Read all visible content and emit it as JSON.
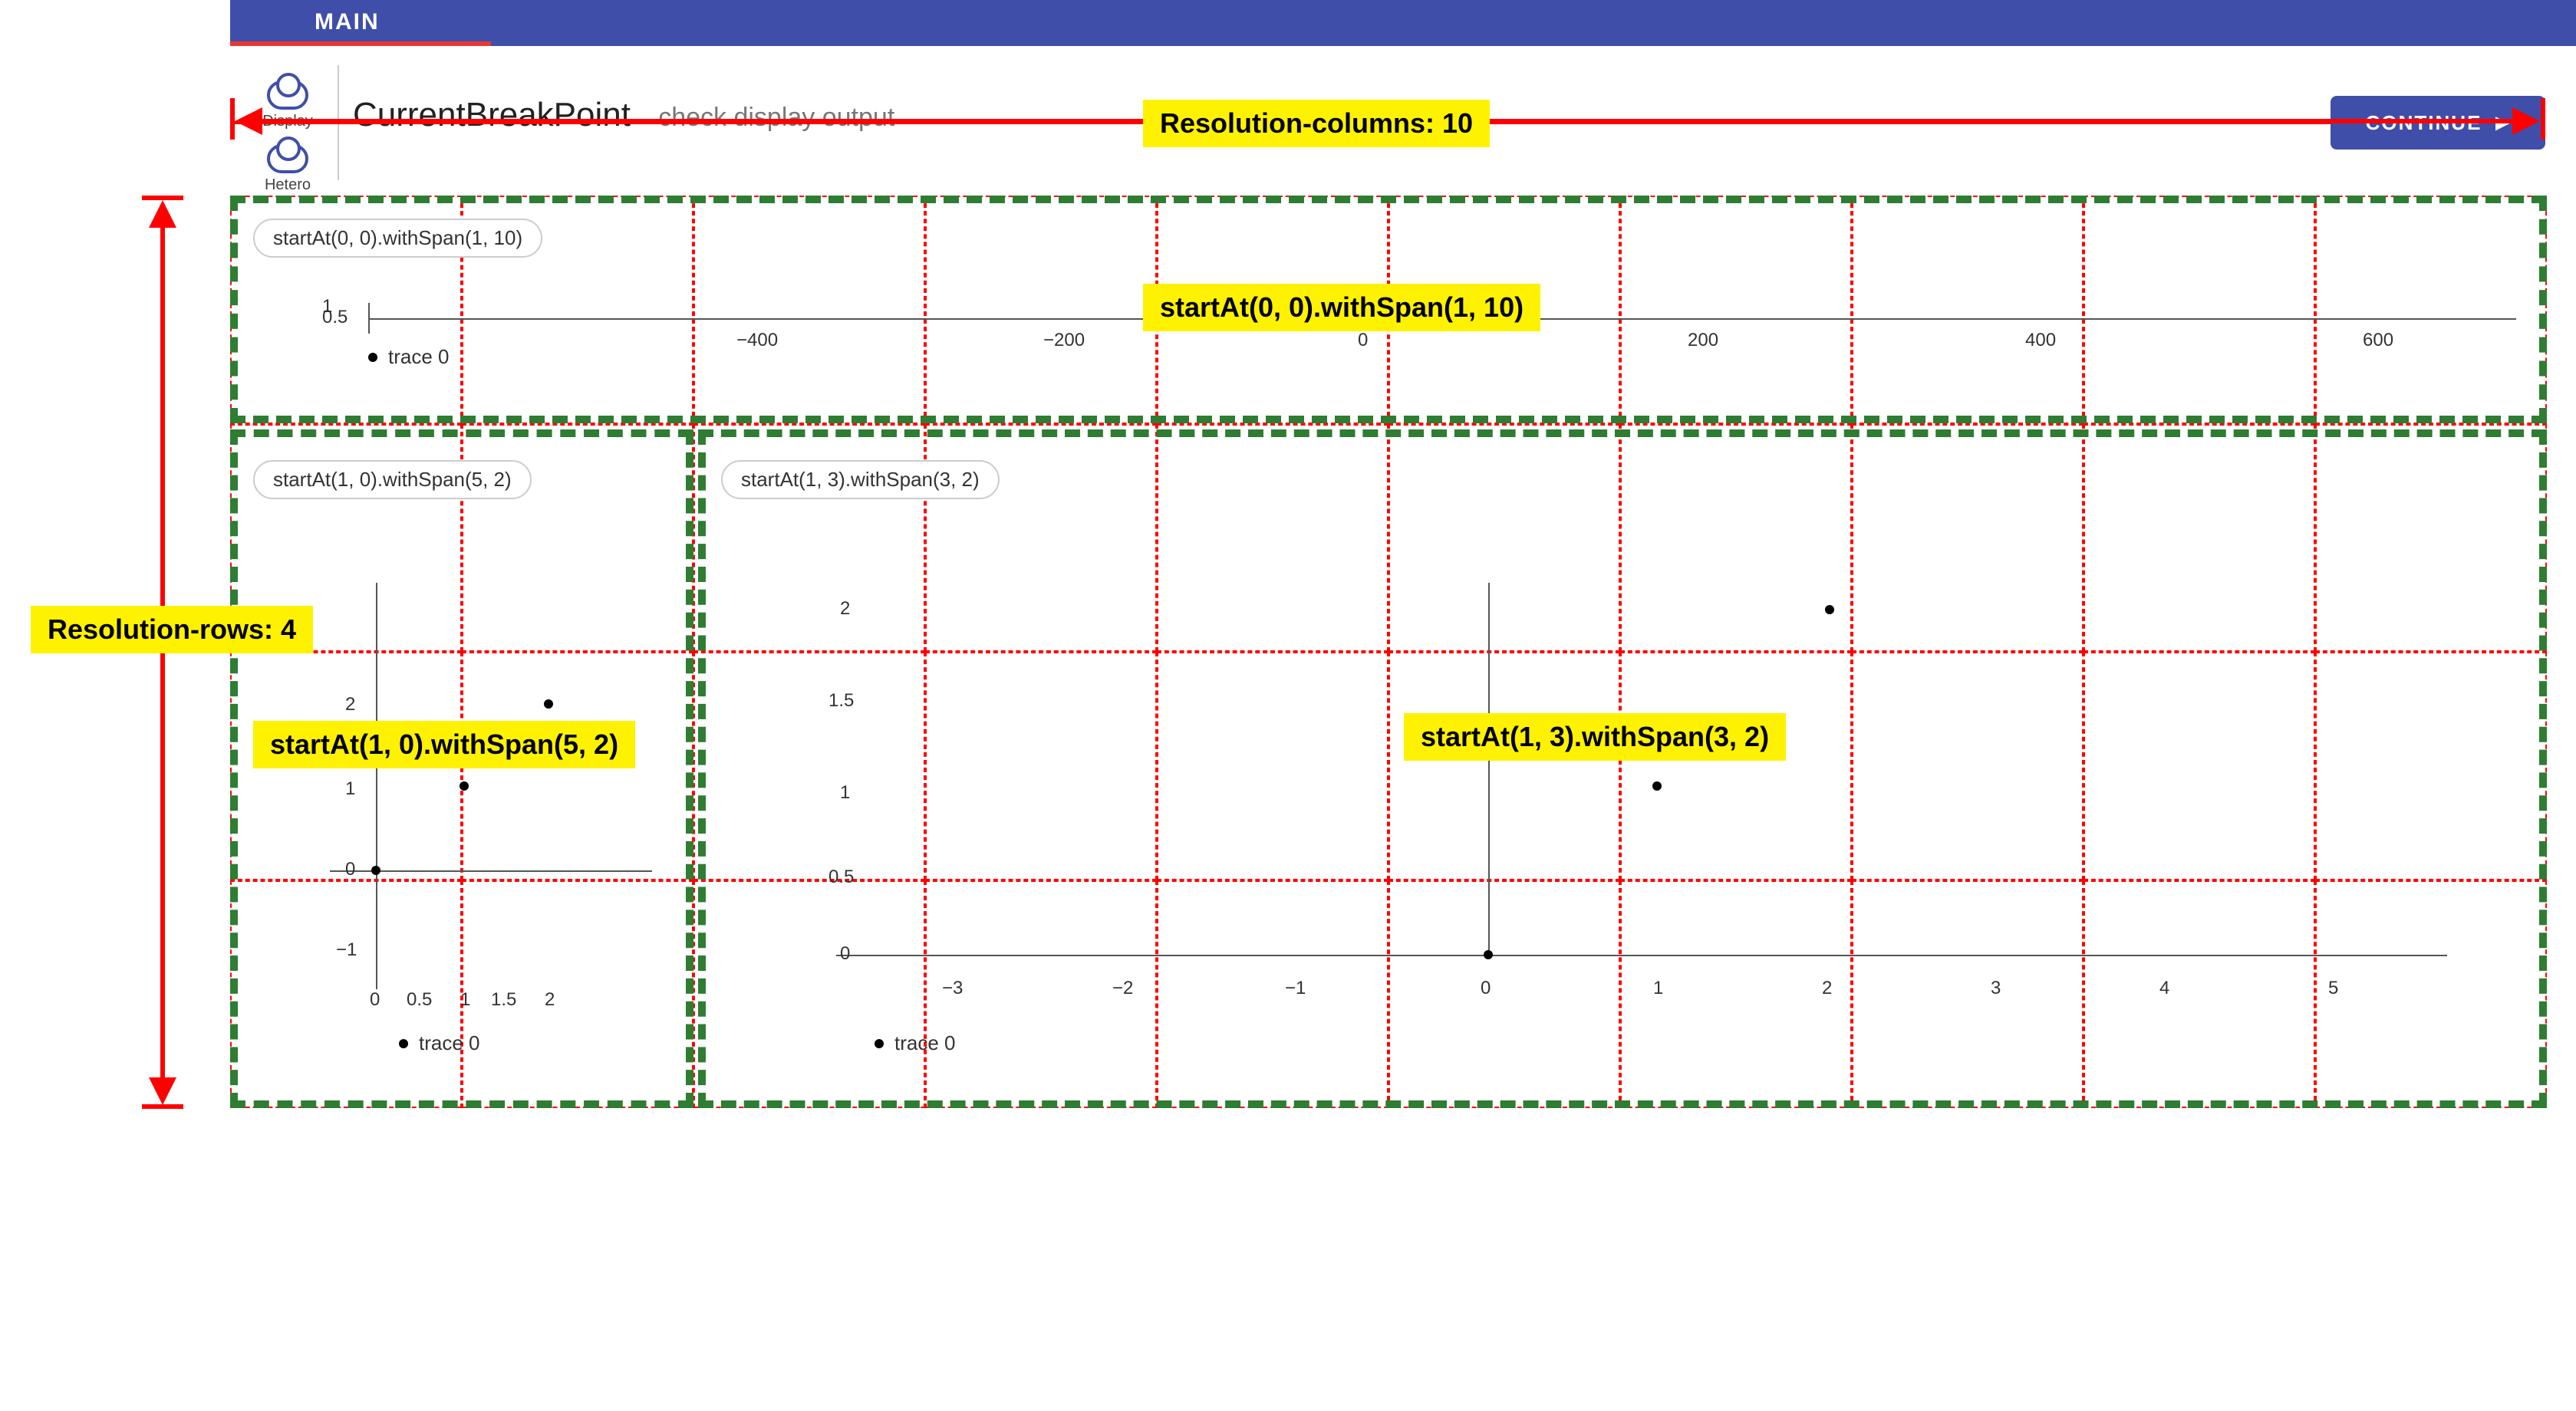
{
  "header": {
    "tab_label": "MAIN",
    "page_title": "CurrentBreakPoint",
    "page_subtitle": "check display output",
    "continue_label": "CONTINUE"
  },
  "sidebar": {
    "items": [
      {
        "label": "Display"
      },
      {
        "label": "Hetero"
      }
    ]
  },
  "grid": {
    "columns": 10,
    "rows": 4
  },
  "annotations": {
    "columns_label": "Resolution-columns: 10",
    "rows_label": "Resolution-rows: 4",
    "panel0_label": "startAt(0, 0).withSpan(1, 10)",
    "panel1_label": "startAt(1, 0).withSpan(5, 2)",
    "panel2_label": "startAt(1, 3).withSpan(3, 2)"
  },
  "panels": [
    {
      "chip": "startAt(0, 0).withSpan(1, 10)",
      "legend": "trace 0",
      "start": [
        0,
        0
      ],
      "span": [
        1,
        10
      ]
    },
    {
      "chip": "startAt(1, 0).withSpan(5, 2)",
      "legend": "trace 0",
      "start": [
        1,
        0
      ],
      "span": [
        5,
        2
      ]
    },
    {
      "chip": "startAt(1, 3).withSpan(3, 2)",
      "legend": "trace 0",
      "start": [
        1,
        3
      ],
      "span": [
        3,
        2
      ]
    }
  ],
  "chart_data": [
    {
      "type": "scatter",
      "title": "startAt(0, 0).withSpan(1, 10)",
      "x_ticks": [
        -400,
        -200,
        0,
        200,
        400,
        600
      ],
      "y_ticks": [
        0.5,
        1
      ],
      "xlim": [
        -500,
        700
      ],
      "ylim": [
        0,
        1
      ],
      "series": [
        {
          "name": "trace 0",
          "x": [
            0
          ],
          "y": [
            0.5
          ]
        }
      ]
    },
    {
      "type": "scatter",
      "title": "startAt(1, 0).withSpan(5, 2)",
      "x_ticks": [
        0,
        0.5,
        1,
        1.5,
        2
      ],
      "y_ticks": [
        -1,
        0,
        1,
        2
      ],
      "xlim": [
        -0.2,
        2.2
      ],
      "ylim": [
        -1.5,
        2.5
      ],
      "series": [
        {
          "name": "trace 0",
          "x": [
            0,
            1,
            2
          ],
          "y": [
            0,
            1,
            2
          ]
        }
      ]
    },
    {
      "type": "scatter",
      "title": "startAt(1, 3).withSpan(3, 2)",
      "x_ticks": [
        -3,
        -2,
        -1,
        0,
        1,
        2,
        3,
        4,
        5
      ],
      "y_ticks": [
        0,
        0.5,
        1,
        1.5,
        2
      ],
      "xlim": [
        -3.5,
        5.5
      ],
      "ylim": [
        -0.1,
        2.2
      ],
      "series": [
        {
          "name": "trace 0",
          "x": [
            0,
            1,
            2
          ],
          "y": [
            0,
            1,
            2
          ]
        }
      ]
    }
  ]
}
